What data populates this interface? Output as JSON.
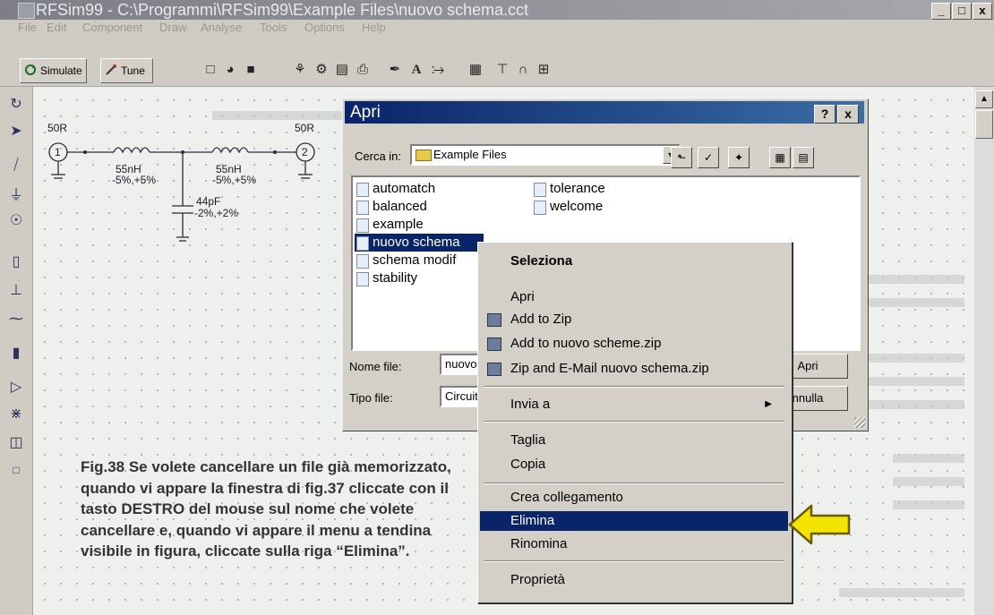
{
  "window": {
    "title": "RFSim99 - C:\\Programmi\\RFSim99\\Example Files\\nuovo schema.cct",
    "controls": [
      "_",
      "□",
      "x"
    ]
  },
  "menubar": [
    "File",
    "Edit",
    "Component",
    "Draw",
    "Analyse",
    "Tools",
    "Options",
    "Help"
  ],
  "toolbar": {
    "simulate_label": "Simulate",
    "tune_label": "Tune"
  },
  "schematic": {
    "port1_label": "50R",
    "port1_num": "1",
    "port2_label": "50R",
    "port2_num": "2",
    "inductor1_value": "55nH",
    "inductor1_tol": "-5%,+5%",
    "inductor2_value": "55nH",
    "inductor2_tol": "-5%,+5%",
    "capacitor_value": "44pF",
    "capacitor_tol": "-2%,+2%"
  },
  "dialog": {
    "title": "Apri",
    "help_btn": "?",
    "close_btn": "x",
    "look_in_label": "Cerca in:",
    "look_in_value": "Example Files",
    "files_col1": [
      "automatch",
      "balanced",
      "example",
      "nuovo schema",
      "schema modif",
      "stability"
    ],
    "files_col2": [
      "tolerance",
      "welcome"
    ],
    "selected_file": "nuovo schema",
    "filename_label": "Nome file:",
    "filename_value": "nuovo",
    "filetype_label": "Tipo file:",
    "filetype_value": "Circuit",
    "open_button": "Apri",
    "cancel_button": "nnulla"
  },
  "context_menu": {
    "header": "Seleziona",
    "items": [
      "Apri",
      "Add to Zip",
      "Add to nuovo scheme.zip",
      "Zip and E-Mail nuovo schema.zip",
      "Invia a",
      "Taglia",
      "Copia",
      "Crea collegamento",
      "Elimina",
      "Rinomina",
      "Proprietà"
    ],
    "highlighted": "Elimina"
  },
  "caption": "Fig.38 Se volete cancellare un file già memorizzato, quando vi appare la finestra di fig.37 cliccate con il tasto DESTRO del mouse sul nome che volete cancellare e, quando vi appare il menu a tendina visibile in figura, cliccate sulla riga “Elimina”.",
  "colors": {
    "selection": "#0a246a",
    "arrow": "#f2e400"
  }
}
